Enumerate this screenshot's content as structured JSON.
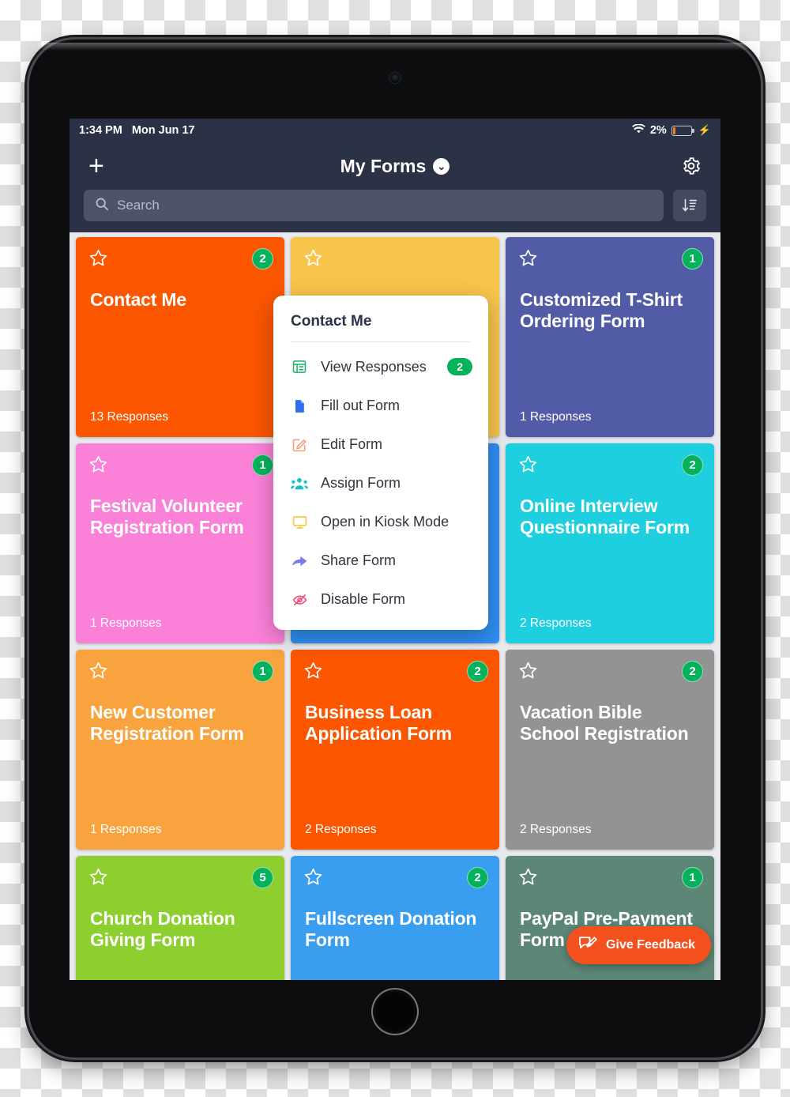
{
  "statusbar": {
    "time": "1:34 PM",
    "date": "Mon Jun 17",
    "battery_percent": "2%",
    "wifi_icon": "wifi-icon",
    "battery_icon": "battery-icon",
    "charging_icon": "lightning-bolt-icon"
  },
  "navbar": {
    "add_label": "+",
    "title": "My Forms",
    "title_chevron": "chevron-down-icon",
    "settings_icon": "gear-icon"
  },
  "search": {
    "placeholder": "Search",
    "value": "",
    "icon": "search-icon",
    "sort_icon": "sort-descending-icon"
  },
  "cards": [
    {
      "title": "Contact Me",
      "responses": "13 Responses",
      "badge": "2",
      "color": "#fc5600",
      "star": "star-outline-icon"
    },
    {
      "title": "",
      "responses": "",
      "badge": "",
      "color": "#f7c44c",
      "star": "star-outline-icon"
    },
    {
      "title": "Customized T-Shirt Ordering Form",
      "responses": "1 Responses",
      "badge": "1",
      "color": "#515ba6",
      "star": "star-outline-icon"
    },
    {
      "title": "",
      "responses": "",
      "badge": "",
      "color": "#f7c44c",
      "star": "star-outline-icon"
    },
    {
      "title": "Festival Volunteer Registration Form",
      "responses": "1 Responses",
      "badge": "1",
      "color": "#fa80d8",
      "star": "star-outline-icon"
    },
    {
      "title": "",
      "responses": "",
      "badge": "",
      "color": "#2f8ef0",
      "star": "star-outline-icon"
    },
    {
      "title": "Online Interview Questionnaire Form",
      "responses": "2 Responses",
      "badge": "2",
      "color": "#1ecfe0",
      "star": "star-outline-icon"
    },
    {
      "title": "New Customer Registration Form",
      "responses": "1 Responses",
      "badge": "1",
      "color": "#f9a33f",
      "star": "star-outline-icon"
    },
    {
      "title": "Business Loan Application Form",
      "responses": "2 Responses",
      "badge": "2",
      "color": "#fc5600",
      "star": "star-outline-icon"
    },
    {
      "title": "Vacation Bible School Registration",
      "responses": "2 Responses",
      "badge": "2",
      "color": "#939393",
      "star": "star-outline-icon"
    },
    {
      "title": "Church Donation Giving Form",
      "responses": "",
      "badge": "5",
      "color": "#8dcf2f",
      "star": "star-outline-icon"
    },
    {
      "title": "Fullscreen Donation Form",
      "responses": "",
      "badge": "2",
      "color": "#3a9ef0",
      "star": "star-outline-icon"
    },
    {
      "title": "PayPal Pre-Payment Form",
      "responses": "",
      "badge": "1",
      "color": "#5c8675",
      "star": "star-outline-icon"
    }
  ],
  "popup": {
    "title": "Contact Me",
    "items": [
      {
        "label": "View Responses",
        "badge": "2",
        "icon": "table-grid-icon",
        "color": "#16b364"
      },
      {
        "label": "Fill out Form",
        "badge": "",
        "icon": "document-icon",
        "color": "#2f6df0"
      },
      {
        "label": "Edit Form",
        "badge": "",
        "icon": "edit-pencil-square-icon",
        "color": "#f59a72"
      },
      {
        "label": "Assign Form",
        "badge": "",
        "icon": "people-group-icon",
        "color": "#18c0c8"
      },
      {
        "label": "Open in Kiosk Mode",
        "badge": "",
        "icon": "monitor-icon",
        "color": "#f7c93c"
      },
      {
        "label": "Share Form",
        "badge": "",
        "icon": "share-arrow-icon",
        "color": "#7b79e8"
      },
      {
        "label": "Disable Form",
        "badge": "",
        "icon": "eye-slash-icon",
        "color": "#f54b7a"
      }
    ]
  },
  "feedback": {
    "label": "Give Feedback",
    "icon": "feedback-pencil-icon",
    "color": "#f4511e"
  }
}
